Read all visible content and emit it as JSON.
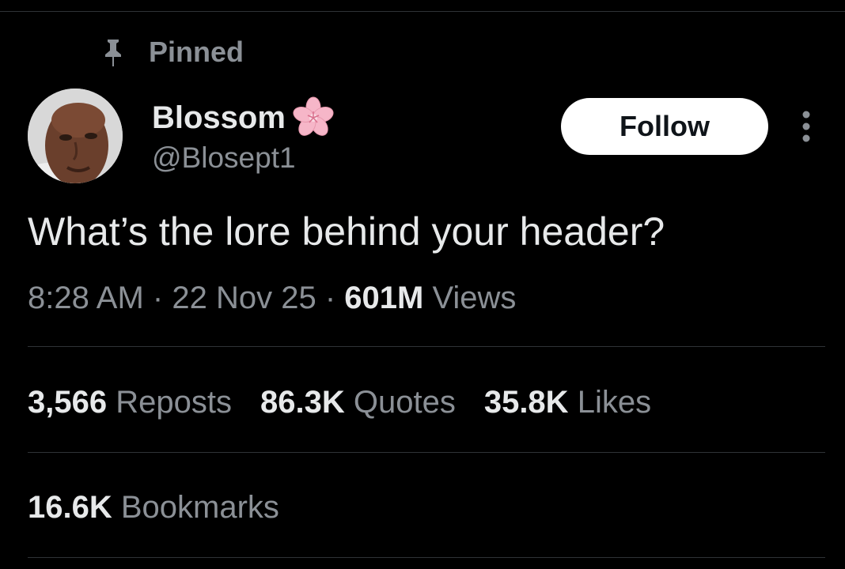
{
  "pinned_label": "Pinned",
  "author": {
    "display_name": "Blossom",
    "handle": "@Blosept1",
    "badge_icon": "cherry-blossom-icon"
  },
  "follow_label": "Follow",
  "more_icon": "more-vertical-icon",
  "tweet": {
    "text": "What’s the lore behind your header?",
    "time": "8:28 AM",
    "date": "22 Nov 25",
    "views_count": "601M",
    "views_label": "Views",
    "separator": "·"
  },
  "stats": {
    "reposts": {
      "count": "3,566",
      "label": "Reposts"
    },
    "quotes": {
      "count": "86.3K",
      "label": "Quotes"
    },
    "likes": {
      "count": "35.8K",
      "label": "Likes"
    },
    "bookmarks": {
      "count": "16.6K",
      "label": "Bookmarks"
    }
  },
  "colors": {
    "background": "#000000",
    "primary_text": "#e7e9ea",
    "secondary_text": "#8b9096",
    "divider": "#2f3336",
    "follow_bg": "#ffffff",
    "blossom_pink": "#f6b6c8"
  }
}
